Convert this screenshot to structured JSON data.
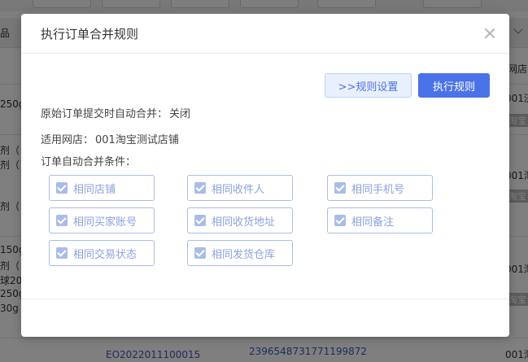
{
  "background": {
    "header_col_left": "品",
    "header_col_right": "网店",
    "rows": [
      {
        "left": "250g",
        "right": "001济"
      },
      {
        "left": "剂（",
        "right": ""
      },
      {
        "left": "剂（",
        "right": "001淘"
      },
      {
        "left": "剂（",
        "right": ""
      },
      {
        "left": "150g",
        "right": ""
      },
      {
        "left": "剂（",
        "right": "001淘"
      },
      {
        "left": "球200",
        "right": ""
      },
      {
        "left": "250g",
        "right": ""
      },
      {
        "left": "30g *",
        "right": ""
      }
    ],
    "tags": [
      "淘宝",
      "淘宝",
      "淘宝"
    ],
    "order_no": "EO2022011100015",
    "trade_no": "2396548731771199872",
    "bottom_right": "001淘"
  },
  "dialog": {
    "title": "执行订单合并规则",
    "settings_button": ">>规则设置",
    "execute_button": "执行规则",
    "auto_merge_label": "原始订单提交时自动合并：",
    "auto_merge_value": "关闭",
    "shop_label": "适用网店：",
    "shop_value": "001淘宝测试店铺",
    "conditions_title": "订单自动合并条件：",
    "conditions": [
      {
        "label": "相同店铺",
        "checked": true
      },
      {
        "label": "相同收件人",
        "checked": true
      },
      {
        "label": "相同手机号",
        "checked": true
      },
      {
        "label": "相同买家账号",
        "checked": true
      },
      {
        "label": "相同收货地址",
        "checked": true
      },
      {
        "label": "相同备注",
        "checked": true
      },
      {
        "label": "相同交易状态",
        "checked": true
      },
      {
        "label": "相同发货仓库",
        "checked": true
      }
    ]
  },
  "colors": {
    "primary": "#4a72e8",
    "checkbox": "#a9bde9",
    "overlay": "rgba(0,0,0,0.5)"
  }
}
